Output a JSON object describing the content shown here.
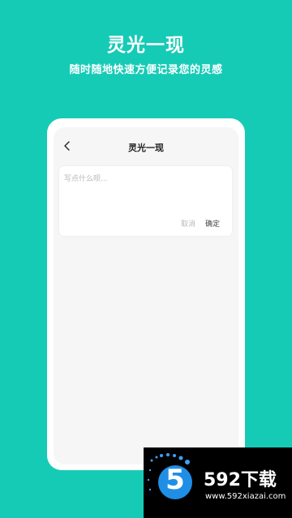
{
  "hero": {
    "title": "灵光一现",
    "subtitle": "随时随地快速方便记录您的灵感"
  },
  "screen": {
    "nav": {
      "back_icon": "chevron-left-icon",
      "title": "灵光一现"
    },
    "note": {
      "placeholder": "写点什么呗...",
      "value": "",
      "cancel_label": "取消",
      "confirm_label": "确定"
    }
  },
  "watermark": {
    "badge": "5",
    "brand": "592下载",
    "url": "www.592xiazai.com"
  },
  "colors": {
    "background": "#16cbb6",
    "card": "#ffffff",
    "screen_bg": "#f6f6f6",
    "placeholder": "#b7b7b7",
    "badge": "#1f8fe6"
  }
}
